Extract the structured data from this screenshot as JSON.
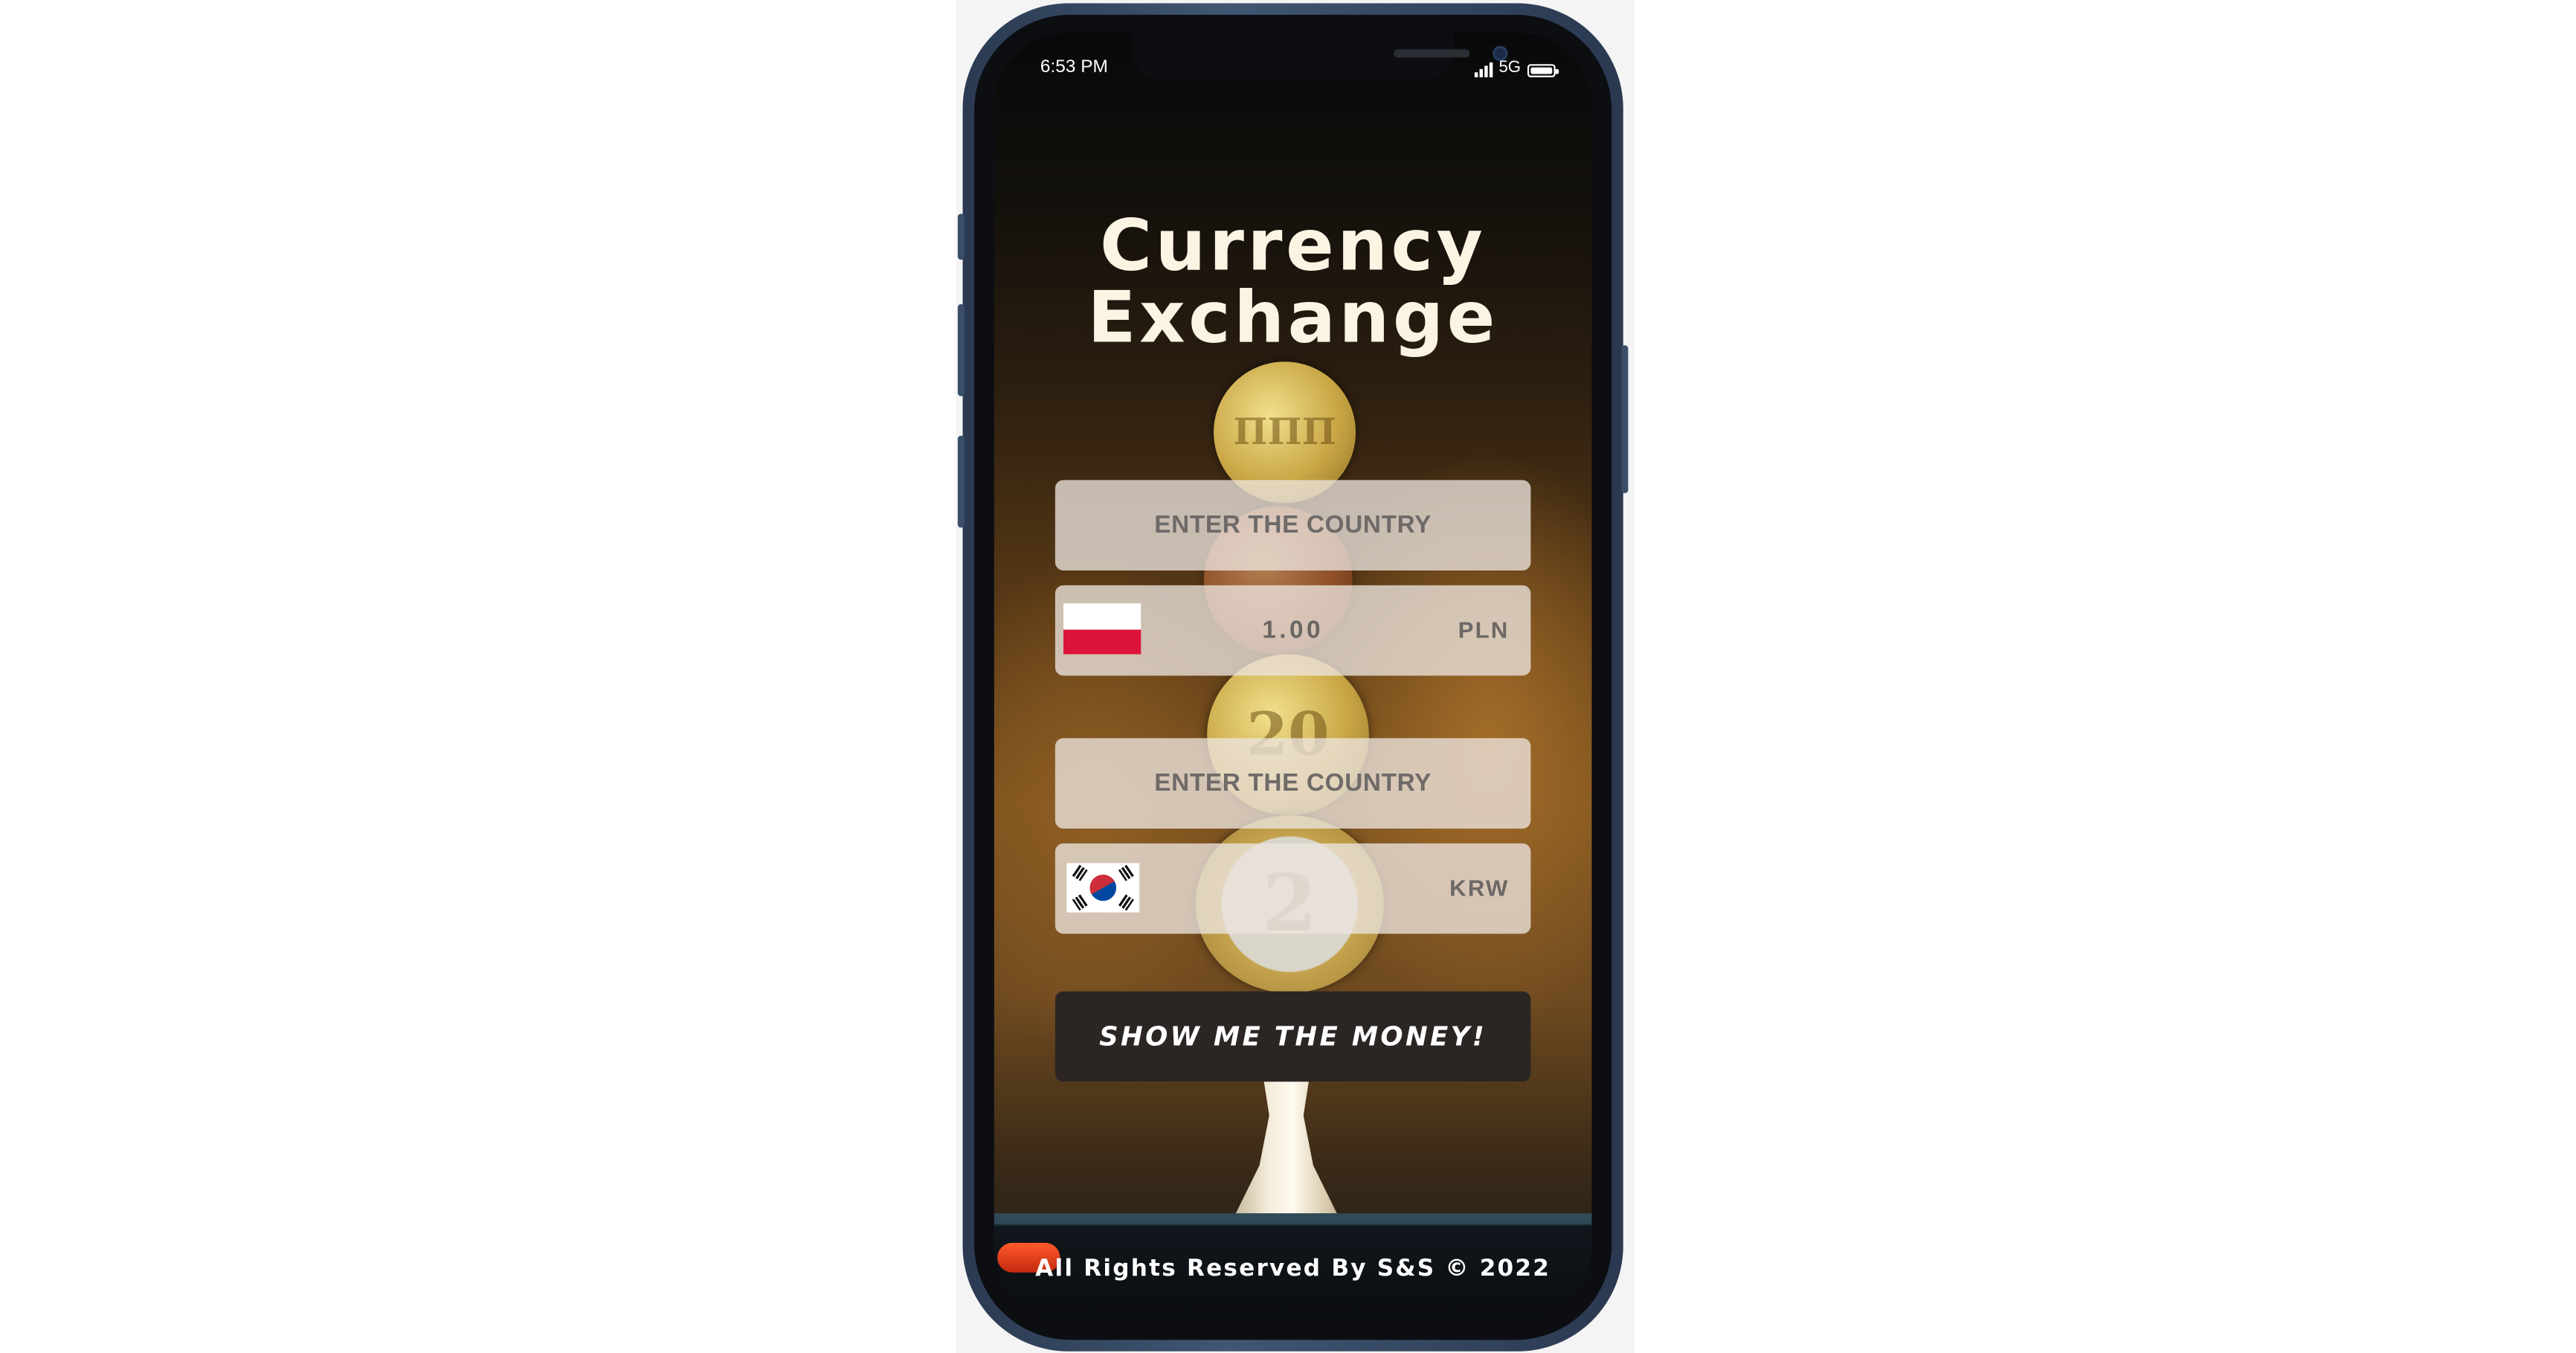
{
  "status_bar": {
    "time": "6:53 PM",
    "network": "5G"
  },
  "app": {
    "title_line1": "Currency",
    "title_line2": "Exchange"
  },
  "from": {
    "country_placeholder": "ENTER THE COUNTRY",
    "amount": "1.00",
    "currency_code": "PLN",
    "flag": "poland-flag-icon"
  },
  "to": {
    "country_placeholder": "ENTER THE COUNTRY",
    "amount": "",
    "currency_code": "KRW",
    "flag": "south-korea-flag-icon"
  },
  "action": {
    "label": "SHOW ME THE MONEY!"
  },
  "footer": {
    "text": "All Rights Reserved By S&S © 2022"
  },
  "colors": {
    "button_bg": "#2b2624",
    "title_text": "#fbf4e3",
    "field_bg": "#ece4de"
  }
}
